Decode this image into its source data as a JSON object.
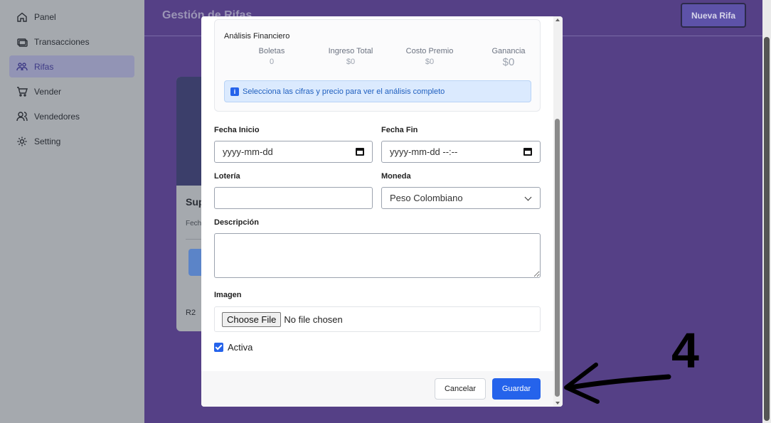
{
  "sidebar": {
    "items": [
      {
        "label": "Panel",
        "icon": "home-icon"
      },
      {
        "label": "Transacciones",
        "icon": "transactions-icon"
      },
      {
        "label": "Rifas",
        "icon": "raffle-icon",
        "active": true
      },
      {
        "label": "Vender",
        "icon": "cart-icon"
      },
      {
        "label": "Vendedores",
        "icon": "users-icon"
      },
      {
        "label": "Setting",
        "icon": "gear-icon"
      }
    ]
  },
  "header": {
    "title": "Gestión de Rifas",
    "new_button": "Nueva Rifa"
  },
  "background_card": {
    "title": "Sup",
    "subtitle": "Fech",
    "footer": "R2"
  },
  "modal": {
    "financial": {
      "title": "Análisis Financiero",
      "columns": [
        {
          "label": "Boletas",
          "value": "0"
        },
        {
          "label": "Ingreso Total",
          "value": "$0"
        },
        {
          "label": "Costo Premio",
          "value": "$0"
        },
        {
          "label": "Ganancia",
          "value": "$0"
        }
      ],
      "note": "Selecciona las cifras y precio para ver el análisis completo"
    },
    "fields": {
      "start_date": {
        "label": "Fecha Inicio",
        "placeholder": "yyyy-mm-dd"
      },
      "end_date": {
        "label": "Fecha Fin",
        "placeholder": "yyyy-mm-dd --:--"
      },
      "lottery": {
        "label": "Lotería",
        "value": ""
      },
      "currency": {
        "label": "Moneda",
        "value": "Peso Colombiano"
      },
      "description": {
        "label": "Descripción",
        "value": ""
      },
      "image": {
        "label": "Imagen",
        "button": "Choose File",
        "status": "No file chosen"
      },
      "active": {
        "label": "Activa",
        "checked": true
      }
    },
    "footer": {
      "cancel": "Cancelar",
      "save": "Guardar"
    }
  },
  "annotation": {
    "number": "4"
  },
  "colors": {
    "primary": "#2563eb",
    "main_bg": "#554086",
    "sidebar_bg": "#a5a9ae"
  }
}
